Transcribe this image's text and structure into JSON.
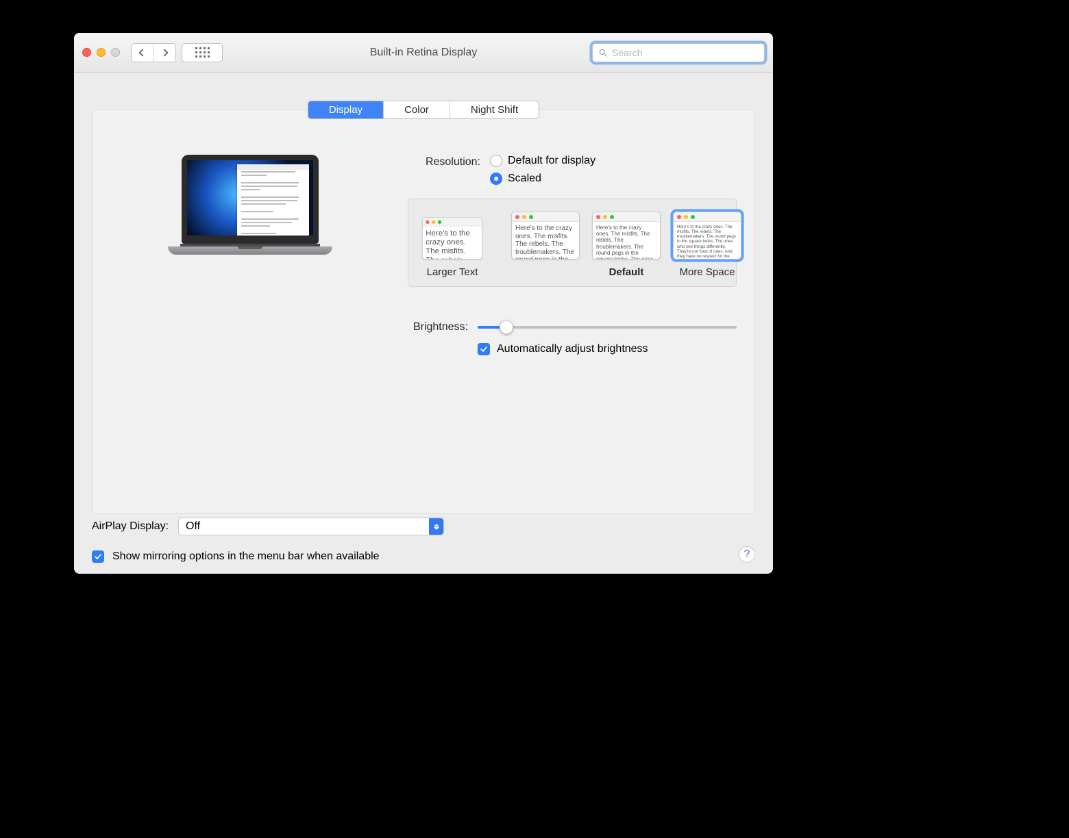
{
  "window": {
    "title": "Built-in Retina Display"
  },
  "search": {
    "placeholder": "Search"
  },
  "tabs": {
    "display": "Display",
    "color": "Color",
    "night_shift": "Night Shift",
    "active": "display"
  },
  "resolution": {
    "label": "Resolution:",
    "default": "Default for display",
    "scaled": "Scaled",
    "selected": "scaled",
    "sample_text": "Here's to the crazy ones. The misfits. The rebels. The troublemakers. The round pegs in the square holes. The ones who see things differently. They're not fond of rules. And they have no respect for the status quo. You can quote them, disagree with them, glorify or vilify them. About the only thing you can't do is ignore them. Because they change things.",
    "labels": {
      "larger": "Larger Text",
      "default": "Default",
      "more": "More Space"
    },
    "selected_index": 3
  },
  "brightness": {
    "label": "Brightness:",
    "value_percent": 11,
    "auto_label": "Automatically adjust brightness",
    "auto_checked": true
  },
  "airplay": {
    "label": "AirPlay Display:",
    "value": "Off"
  },
  "mirroring": {
    "label": "Show mirroring options in the menu bar when available",
    "checked": true
  },
  "help": {
    "symbol": "?"
  }
}
